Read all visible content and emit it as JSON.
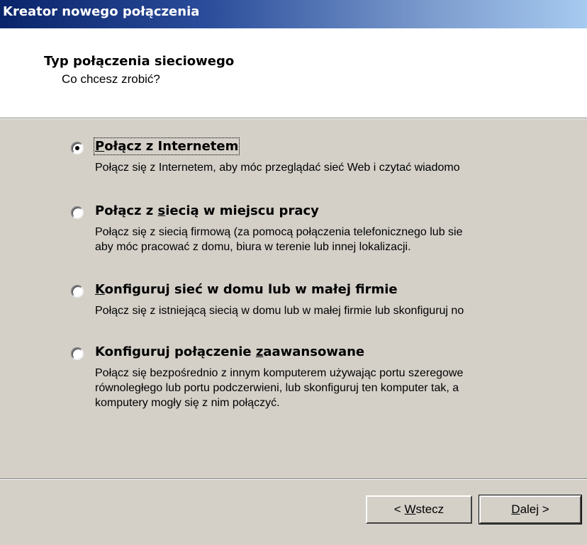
{
  "window": {
    "title": "Kreator nowego połączenia"
  },
  "header": {
    "title": "Typ połączenia sieciowego",
    "subtitle": "Co chcesz zrobić?"
  },
  "options": [
    {
      "label_pre": "",
      "label_ul": "P",
      "label_post": "ołącz z Internetem",
      "selected": true,
      "desc": [
        "Połącz się z Internetem, aby móc przeglądać sieć Web i czytać wiadomo"
      ]
    },
    {
      "label_pre": "Połącz z ",
      "label_ul": "s",
      "label_post": "iecią w miejscu pracy",
      "selected": false,
      "desc": [
        "Połącz się z siecią firmową (za pomocą połączenia telefonicznego lub sie",
        "aby móc pracować z domu, biura w terenie lub innej lokalizacji."
      ]
    },
    {
      "label_pre": "",
      "label_ul": "K",
      "label_post": "onfiguruj sieć w domu lub w małej firmie",
      "selected": false,
      "desc": [
        "Połącz się z istniejącą siecią w domu lub w małej firmie lub skonfiguruj no"
      ]
    },
    {
      "label_pre": "Konfiguruj połączenie ",
      "label_ul": "z",
      "label_post": "aawansowane",
      "selected": false,
      "desc": [
        "Połącz się bezpośrednio z innym komputerem używając portu szeregowe",
        "równoległego lub portu podczerwieni, lub skonfiguruj ten komputer tak, a",
        "komputery mogły się z nim połączyć."
      ]
    }
  ],
  "buttons": {
    "back": {
      "pre": "< ",
      "ul": "W",
      "post": "stecz"
    },
    "next": {
      "pre": "",
      "ul": "D",
      "post": "alej >"
    }
  }
}
